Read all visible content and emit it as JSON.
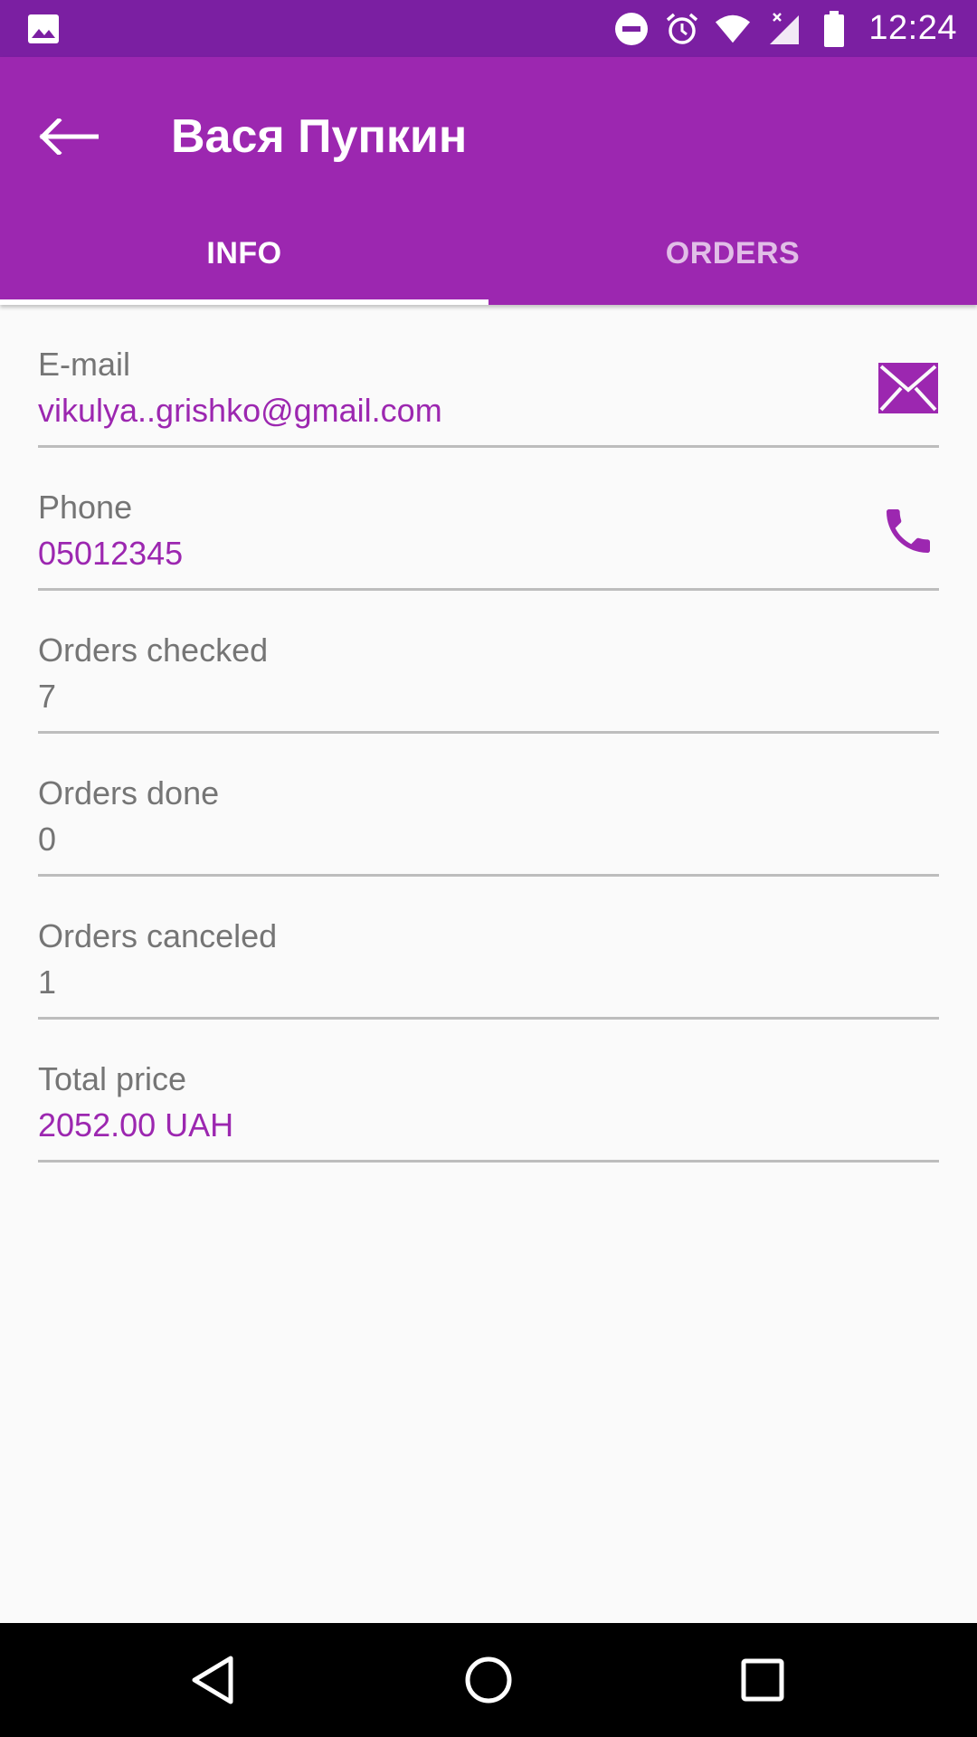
{
  "status_bar": {
    "time": "12:24",
    "icons": [
      "image-notification-icon",
      "do-not-disturb-icon",
      "alarm-icon",
      "wifi-icon",
      "signal-icon",
      "battery-icon"
    ]
  },
  "app_bar": {
    "title": "Вася Пупкин",
    "back_icon": "back-arrow-icon",
    "tabs": [
      {
        "label": "INFO",
        "active": true
      },
      {
        "label": "ORDERS",
        "active": false
      }
    ]
  },
  "info": {
    "rows": [
      {
        "label": "E-mail",
        "value": "vikulya..grishko@gmail.com",
        "icon": "email-icon"
      },
      {
        "label": "Phone",
        "value": "05012345",
        "icon": "phone-icon"
      },
      {
        "label": "Orders checked",
        "value": "7"
      },
      {
        "label": "Orders done",
        "value": "0"
      },
      {
        "label": "Orders canceled",
        "value": "1"
      },
      {
        "label": "Total price",
        "value": "2052.00 UAH"
      }
    ]
  },
  "colors": {
    "primary": "#9c27b0",
    "primary_dark": "#7b1fa2",
    "tab_inactive": "#e1bee7",
    "text_secondary": "#757575",
    "divider": "#bdbdbd"
  },
  "nav_bar": {
    "icons": [
      "nav-back-icon",
      "nav-home-icon",
      "nav-recents-icon"
    ]
  }
}
